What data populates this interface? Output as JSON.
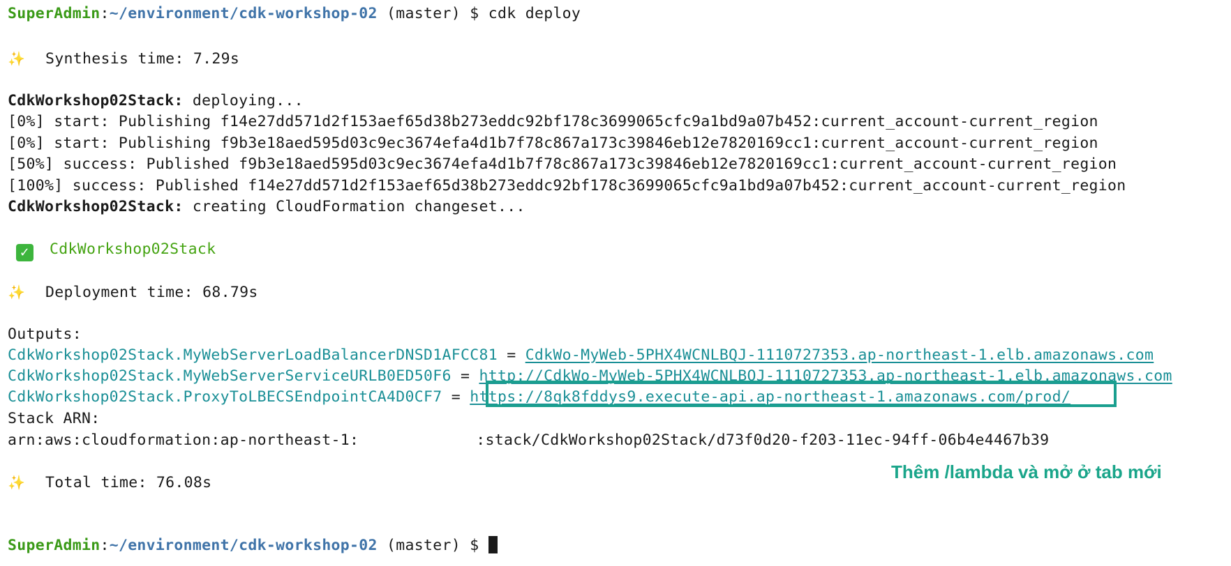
{
  "colors": {
    "user": "#3a9a17",
    "path": "#3f73a8",
    "teal": "#1a8f96",
    "annotation": "#1aa58a",
    "success_green": "#44a311"
  },
  "icons": {
    "sparkle": "sparkles-icon",
    "check": "check-mark-icon"
  },
  "prompt": {
    "user": "SuperAdmin",
    "sep": ":",
    "path": "~/environment/cdk-workshop-02",
    "branch": " (master) $ ",
    "command": "cdk deploy"
  },
  "synthesis": {
    "icon": "✨",
    "text": "Synthesis time: 7.29s"
  },
  "deploying": {
    "stack": "CdkWorkshop02Stack",
    "text": ": deploying..."
  },
  "publish_lines": [
    "[0%] start: Publishing f14e27dd571d2f153aef65d38b273eddc92bf178c3699065cfc9a1bd9a07b452:current_account-current_region",
    "[0%] start: Publishing f9b3e18aed595d03c9ec3674efa4d1b7f78c867a173c39846eb12e7820169cc1:current_account-current_region",
    "[50%] success: Published f9b3e18aed595d03c9ec3674efa4d1b7f78c867a173c39846eb12e7820169cc1:current_account-current_region",
    "[100%] success: Published f14e27dd571d2f153aef65d38b273eddc92bf178c3699065cfc9a1bd9a07b452:current_account-current_region"
  ],
  "changeset": {
    "stack": "CdkWorkshop02Stack",
    "text": ": creating CloudFormation changeset..."
  },
  "stack_done": {
    "icon": "✓",
    "name": "CdkWorkshop02Stack"
  },
  "deployment": {
    "icon": "✨",
    "text": "Deployment time: 68.79s"
  },
  "outputs": {
    "label": "Outputs:",
    "items": [
      {
        "stack": "CdkWorkshop02Stack",
        "key": ".MyWebServerLoadBalancerDNSD1AFCC81",
        "eq": " = ",
        "value": "CdkWo-MyWeb-5PHX4WCNLBQJ-1110727353.ap-northeast-1.elb.amazonaws.com"
      },
      {
        "stack": "CdkWorkshop02Stack",
        "key": ".MyWebServerServiceURLB0ED50F6",
        "eq": " = ",
        "value": "http://CdkWo-MyWeb-5PHX4WCNLBQJ-1110727353.ap-northeast-1.elb.amazonaws.com"
      },
      {
        "stack": "CdkWorkshop02Stack",
        "key": ".ProxyToLBECSEndpointCA4D0CF7",
        "eq": " = ",
        "value": "https://8qk8fddys9.execute-api.ap-northeast-1.amazonaws.com/prod/"
      }
    ]
  },
  "stack_arn": {
    "label": "Stack ARN:",
    "prefix": "arn:aws:cloudformation:ap-northeast-1:",
    "suffix": ":stack/CdkWorkshop02Stack/d73f0d20-f203-11ec-94ff-06b4e4467b39"
  },
  "total": {
    "icon": "✨",
    "text": "Total time: 76.08s"
  },
  "annotation": "Thêm /lambda và mở ở tab mới",
  "prompt_end": {
    "user": "SuperAdmin",
    "sep": ":",
    "path": "~/environment/cdk-workshop-02",
    "branch": " (master) $ "
  }
}
